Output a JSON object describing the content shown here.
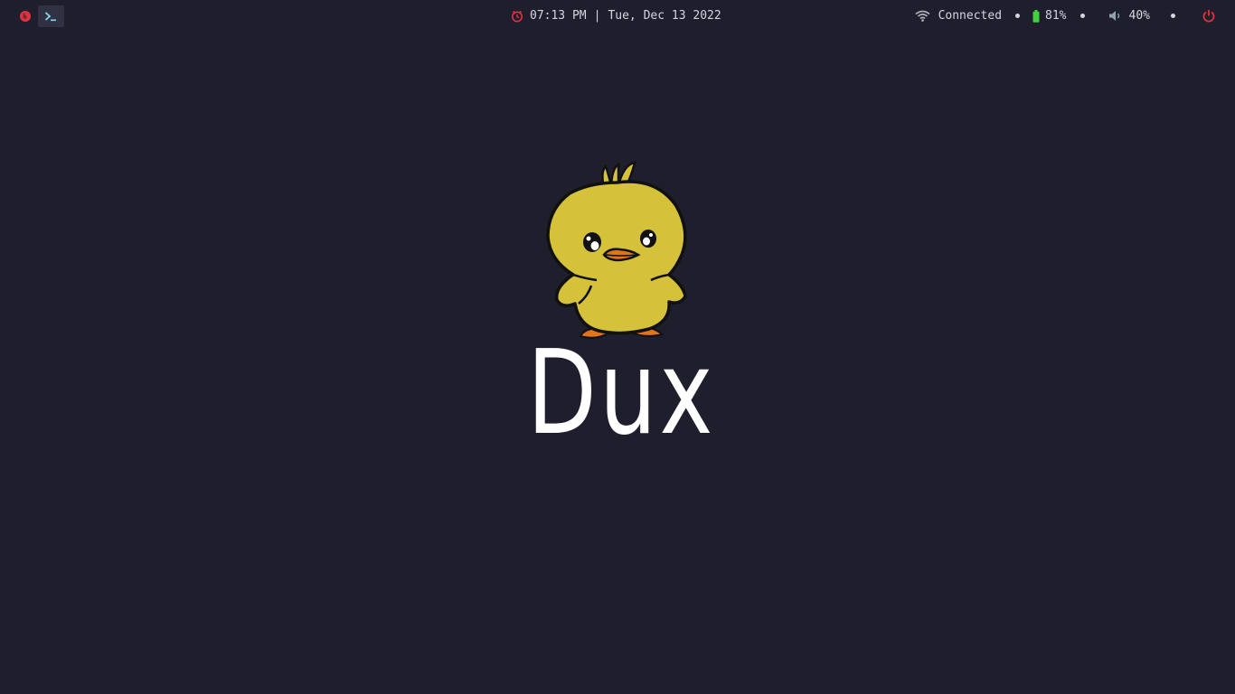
{
  "topbar": {
    "apps": [
      {
        "name": "firefox",
        "icon": "firefox-icon"
      },
      {
        "name": "terminal",
        "icon": "terminal-icon"
      }
    ],
    "clock": {
      "time": "07:13 PM",
      "separator": "|",
      "date": "Tue, Dec 13 2022",
      "icon": "clock-icon"
    },
    "status": {
      "network_label": "Connected",
      "network_icon": "wifi-icon",
      "battery_label": "81%",
      "battery_icon": "battery-icon",
      "volume_label": "40%",
      "volume_icon": "volume-icon",
      "power_icon": "power-icon"
    }
  },
  "splash": {
    "logo": "duck-logo",
    "title": "Dux"
  },
  "colors": {
    "background": "#1e1e2c",
    "accent_red": "#e0333f",
    "battery_green": "#3fd23f",
    "text": "#d4d6e2",
    "duck_yellow": "#d6c23a",
    "duck_orange": "#e2741c"
  }
}
